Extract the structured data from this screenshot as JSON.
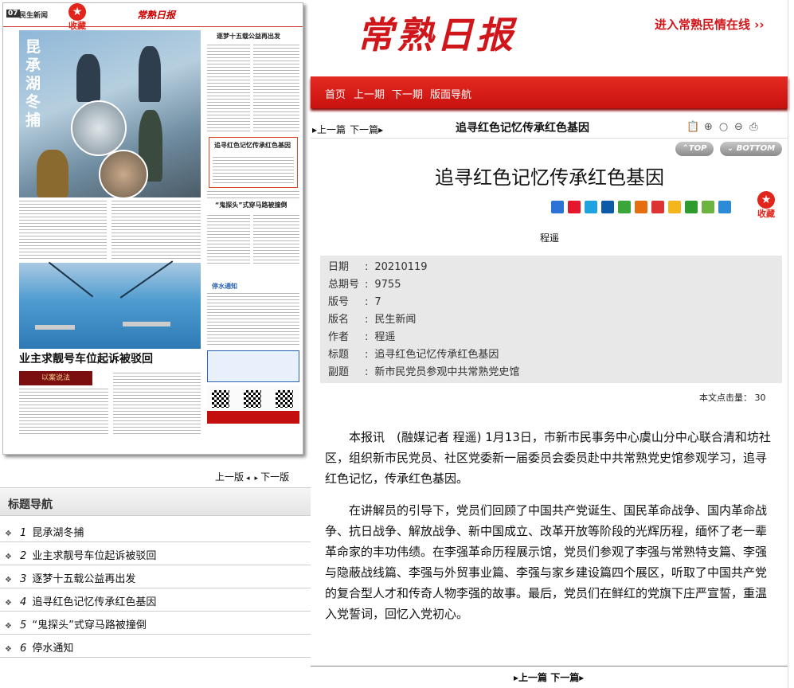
{
  "paper": {
    "page_no": "07",
    "section": "民生新闻",
    "logo_small": "常熟日报",
    "fav_label": "收藏",
    "headline_vertical": "昆承湖冬捕",
    "headline_bottom": "业主求靓号车位起诉被驳回",
    "banner_bottom": "以案说法",
    "headline_box": "追寻红色记忆传承红色基因",
    "headline_top_right": "逐梦十五载公益再出发",
    "headline_mid_right": "“鬼探头”式穿马路被撞倒",
    "notice_label": "停水通知"
  },
  "page_nav": {
    "prev": "上一版",
    "next": "下一版"
  },
  "toc": {
    "title": "标题导航",
    "items": [
      {
        "num": "1",
        "label": "昆承湖冬捕"
      },
      {
        "num": "2",
        "label": "业主求靓号车位起诉被驳回"
      },
      {
        "num": "3",
        "label": "逐梦十五载公益再出发"
      },
      {
        "num": "4",
        "label": "追寻红色记忆传承红色基因"
      },
      {
        "num": "5",
        "label": "“鬼探头”式穿马路被撞倒"
      },
      {
        "num": "6",
        "label": "停水通知"
      }
    ]
  },
  "masthead": {
    "logo": "常熟日报",
    "portal_link": "进入常熟民情在线 ››"
  },
  "nav": [
    "首页",
    "上一期",
    "下一期",
    "版面导航"
  ],
  "article_bar": {
    "prev": "上一篇",
    "next": "下一篇",
    "title": "追寻红色记忆传承红色基因"
  },
  "buttons": {
    "top": "TOP",
    "bottom": "BOTTOM"
  },
  "article": {
    "title": "追寻红色记忆传承红色基因",
    "author": "程遥",
    "fav": "收藏",
    "meta": [
      {
        "key": "日期",
        "value": "20210119"
      },
      {
        "key": "总期号",
        "value": "9755"
      },
      {
        "key": "版号",
        "value": "7"
      },
      {
        "key": "版名",
        "value": "民生新闻"
      },
      {
        "key": "作者",
        "value": "程遥"
      },
      {
        "key": "标题",
        "value": "追寻红色记忆传承红色基因"
      },
      {
        "key": "副题",
        "value": "新市民党员参观中共常熟党史馆"
      }
    ],
    "hits_label": "本文点击量：",
    "hits_value": "30",
    "paragraphs": [
      "本报讯　(融媒记者 程遥) 1月13日，市新市民事务中心虞山分中心联合清和坊社区，组织新市民党员、社区党委新一届委员会委员赴中共常熟党史馆参观学习，追寻红色记忆，传承红色基因。",
      "在讲解员的引导下，党员们回顾了中国共产党诞生、国民革命战争、国内革命战争、抗日战争、解放战争、新中国成立、改革开放等阶段的光辉历程，缅怀了老一辈革命家的丰功伟绩。在李强革命历程展示馆，党员们参观了李强与常熟特支篇、李强与隐蔽战线篇、李强与外贸事业篇、李强与家乡建设篇四个展区，听取了中国共产党的复合型人才和传奇人物李强的故事。最后，党员们在鲜红的党旗下庄严宣誓，重温入党誓词，回忆入党初心。"
    ]
  },
  "bottom_nav": {
    "prev": "上一篇",
    "next": "下一篇"
  },
  "colors": {
    "brand_red": "#d0161b",
    "nav_red": "#d8140f",
    "meta_bg": "#e8e8e8"
  }
}
